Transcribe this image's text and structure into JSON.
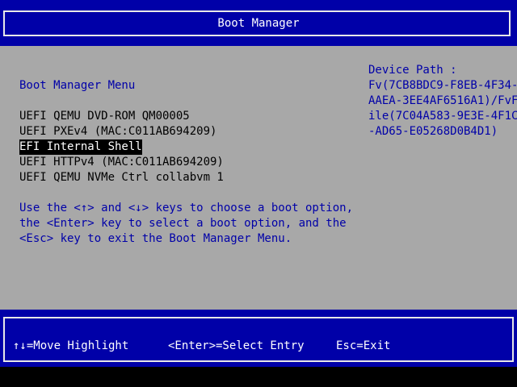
{
  "header": {
    "title": "Boot Manager"
  },
  "menu": {
    "title": "Boot Manager Menu",
    "entries": [
      {
        "label": "UEFI QEMU DVD-ROM QM00005"
      },
      {
        "label": "UEFI PXEv4 (MAC:C011AB694209)"
      },
      {
        "label": "EFI Internal Shell"
      },
      {
        "label": "UEFI HTTPv4 (MAC:C011AB694209)"
      },
      {
        "label": "UEFI QEMU NVMe Ctrl collabvm 1"
      }
    ],
    "selected_index": 2
  },
  "help": {
    "lines": [
      "Use the <↑> and <↓> keys to choose a boot option,",
      "the <Enter> key to select a boot option, and the",
      "<Esc> key to exit the Boot Manager Menu."
    ]
  },
  "device_path": {
    "label": "Device Path :",
    "lines": [
      "Fv(7CB8BDC9-F8EB-4F34-",
      "AAEA-3EE4AF6516A1)/FvF",
      "ile(7C04A583-9E3E-4F1C",
      "-AD65-E05268D0B4D1)"
    ]
  },
  "footer": {
    "move_highlight": "↑↓=Move Highlight",
    "select_entry": "<Enter>=Select Entry",
    "exit": "Esc=Exit"
  },
  "colors": {
    "bios_blue": "#0000a8",
    "bios_grey": "#a8a8a8",
    "frame_white": "#e8e8e8",
    "selection_bg": "#000000",
    "selection_fg": "#ffffff"
  }
}
